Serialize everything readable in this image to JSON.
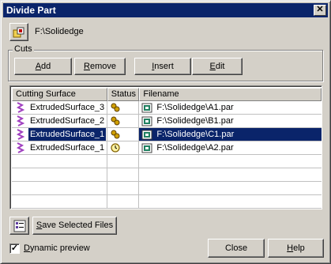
{
  "window": {
    "title": "Divide Part",
    "close_glyph": "✕"
  },
  "path": {
    "value": "F:\\Solidedge"
  },
  "cuts": {
    "legend": "Cuts",
    "add": {
      "pre": "",
      "key": "A",
      "post": "dd"
    },
    "remove": {
      "pre": "",
      "key": "R",
      "post": "emove"
    },
    "insert": {
      "pre": "",
      "key": "I",
      "post": "nsert"
    },
    "edit": {
      "pre": "",
      "key": "E",
      "post": "dit"
    }
  },
  "table": {
    "headers": [
      "Cutting Surface",
      "Status",
      "Filename"
    ],
    "rows": [
      {
        "surface": "ExtrudedSurface_3",
        "status": "part-icon",
        "filename": "F:\\Solidedge\\A1.par",
        "selected": false
      },
      {
        "surface": "ExtrudedSurface_2",
        "status": "part-icon",
        "filename": "F:\\Solidedge\\B1.par",
        "selected": false
      },
      {
        "surface": "ExtrudedSurface_1",
        "status": "part-icon",
        "filename": "F:\\Solidedge\\C1.par",
        "selected": true
      },
      {
        "surface": "ExtrudedSurface_1",
        "status": "clock-icon",
        "filename": "F:\\Solidedge\\A2.par",
        "selected": false
      }
    ]
  },
  "footer": {
    "save_selected": {
      "pre": "",
      "key": "S",
      "post": "ave Selected Files"
    },
    "dynamic_preview": {
      "pre": "",
      "key": "D",
      "post": "ynamic preview",
      "checked": true,
      "mark": "✓"
    },
    "close": "Close",
    "help": {
      "pre": "",
      "key": "H",
      "post": "elp"
    }
  },
  "colors": {
    "selection": "#0a246a",
    "face": "#d4d0c8",
    "surface_icon": "#a040c0"
  }
}
